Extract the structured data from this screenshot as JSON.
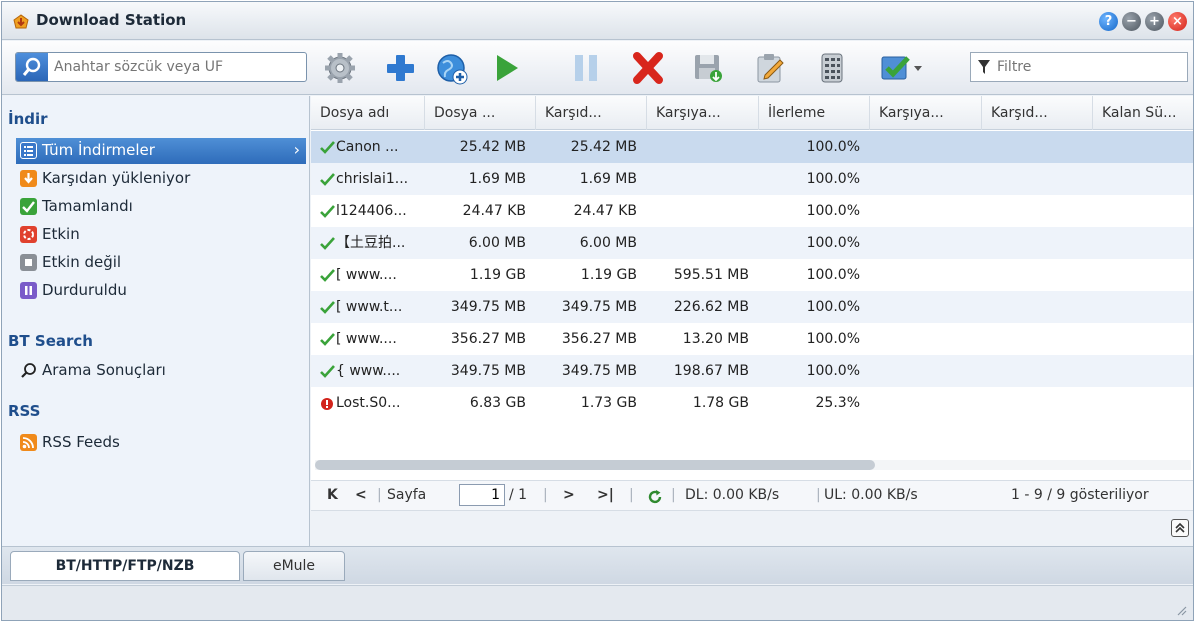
{
  "window": {
    "title": "Download Station",
    "controls": {
      "help": "?",
      "minimize": "−",
      "maximize": "+",
      "close": "×"
    }
  },
  "toolbar": {
    "search_placeholder": "Anahtar sözcük veya UF",
    "filter_placeholder": "Filtre",
    "icons": [
      "gear-icon",
      "add-icon",
      "add-url-icon",
      "play-icon",
      "pause-icon",
      "delete-icon",
      "save-icon",
      "edit-icon",
      "clear-completed-icon",
      "select-menu-icon"
    ]
  },
  "sidebar": {
    "section_download": "İndir",
    "items": [
      {
        "label": "Tüm İndirmeler",
        "icon": "list-icon",
        "color": "#3a78c9"
      },
      {
        "label": "Karşıdan yükleniyor",
        "icon": "download-icon",
        "color": "#f08a1a"
      },
      {
        "label": "Tamamlandı",
        "icon": "check-icon",
        "color": "#3aa33a"
      },
      {
        "label": "Etkin",
        "icon": "active-icon",
        "color": "#e0412e"
      },
      {
        "label": "Etkin değil",
        "icon": "inactive-icon",
        "color": "#8a8f96"
      },
      {
        "label": "Durduruldu",
        "icon": "pause-icon",
        "color": "#7a5bc9"
      }
    ],
    "section_bt": "BT Search",
    "bt_items": [
      {
        "label": "Arama Sonuçları",
        "icon": "search-icon"
      }
    ],
    "section_rss": "RSS",
    "rss_items": [
      {
        "label": "RSS Feeds",
        "icon": "rss-icon",
        "color": "#f08a1a"
      }
    ]
  },
  "grid": {
    "columns": [
      "Dosya adı",
      "Dosya ...",
      "Karşıd...",
      "Karşıya...",
      "İlerleme",
      "Karşıya...",
      "Karşıd...",
      "Kalan Sü..."
    ],
    "rows": [
      {
        "status": "done",
        "name": "Canon ...",
        "size": "25.42 MB",
        "downloaded": "25.42 MB",
        "uploaded": "",
        "progress": "100.0%"
      },
      {
        "status": "done",
        "name": "chrislai1...",
        "size": "1.69 MB",
        "downloaded": "1.69 MB",
        "uploaded": "",
        "progress": "100.0%"
      },
      {
        "status": "done",
        "name": "l124406...",
        "size": "24.47 KB",
        "downloaded": "24.47 KB",
        "uploaded": "",
        "progress": "100.0%"
      },
      {
        "status": "done",
        "name": "【土豆拍...",
        "size": "6.00 MB",
        "downloaded": "6.00 MB",
        "uploaded": "",
        "progress": "100.0%"
      },
      {
        "status": "done",
        "name": "[ www....",
        "size": "1.19 GB",
        "downloaded": "1.19 GB",
        "uploaded": "595.51 MB",
        "progress": "100.0%"
      },
      {
        "status": "done",
        "name": "[ www.t...",
        "size": "349.75 MB",
        "downloaded": "349.75 MB",
        "uploaded": "226.62 MB",
        "progress": "100.0%"
      },
      {
        "status": "done",
        "name": "[ www....",
        "size": "356.27 MB",
        "downloaded": "356.27 MB",
        "uploaded": "13.20 MB",
        "progress": "100.0%"
      },
      {
        "status": "done",
        "name": "{ www....",
        "size": "349.75 MB",
        "downloaded": "349.75 MB",
        "uploaded": "198.67 MB",
        "progress": "100.0%"
      },
      {
        "status": "error",
        "name": "Lost.S0...",
        "size": "6.83 GB",
        "downloaded": "1.73 GB",
        "uploaded": "1.78 GB",
        "progress": "25.3%"
      }
    ]
  },
  "pager": {
    "first": "K",
    "prev": "<",
    "page_label": "Sayfa",
    "page_value": "1",
    "page_total": "/ 1",
    "next": ">",
    "last": ">|",
    "dl_rate": "DL: 0.00 KB/s",
    "ul_rate": "UL: 0.00 KB/s",
    "showing": "1 - 9 / 9 gösteriliyor"
  },
  "tabs": [
    {
      "label": "BT/HTTP/FTP/NZB",
      "active": true
    },
    {
      "label": "eMule",
      "active": false
    }
  ],
  "colors": {
    "accent": "#2e6cba",
    "success": "#3aa33a",
    "error": "#d2231b"
  }
}
